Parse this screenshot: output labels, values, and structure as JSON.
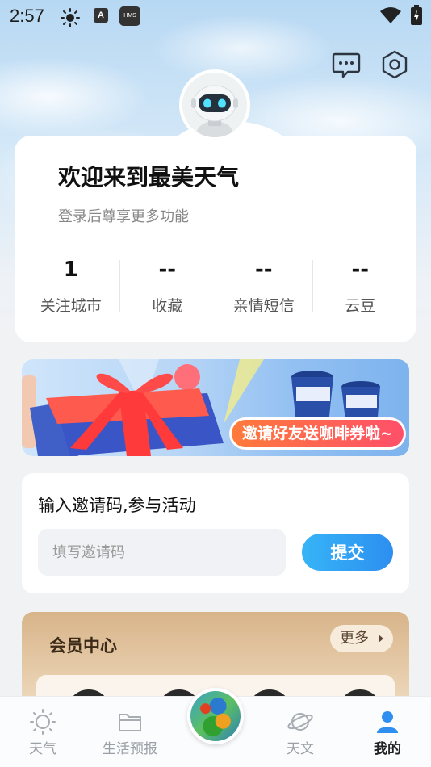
{
  "status_bar": {
    "time": "2:57",
    "icons": [
      "sun-icon",
      "a-icon",
      "hms-icon",
      "wifi-icon",
      "battery-icon"
    ],
    "a_label": "A",
    "hms_label": "HMS"
  },
  "header": {
    "message_icon": "chat-bubble-icon",
    "settings_icon": "hexagon-settings-icon"
  },
  "profile": {
    "avatar_icon": "robot-avatar",
    "title": "欢迎来到最美天气",
    "subtitle": "登录后尊享更多功能",
    "stats": [
      {
        "value": "1",
        "label": "关注城市"
      },
      {
        "value": "--",
        "label": "收藏"
      },
      {
        "value": "--",
        "label": "亲情短信"
      },
      {
        "value": "--",
        "label": "云豆"
      }
    ]
  },
  "banner": {
    "text": "邀请好友送咖啡券啦~"
  },
  "invite": {
    "title": "输入邀请码,参与活动",
    "input_value": "",
    "input_placeholder": "填写邀请码",
    "submit_label": "提交"
  },
  "member": {
    "title": "会员中心",
    "more_label": "更多"
  },
  "nav": {
    "items": [
      {
        "label": "天气",
        "icon": "sun-outline-icon",
        "active": false
      },
      {
        "label": "生活预报",
        "icon": "folder-icon",
        "active": false
      },
      {
        "label": "",
        "icon": "radar-map-icon",
        "active": false
      },
      {
        "label": "天文",
        "icon": "planet-icon",
        "active": false
      },
      {
        "label": "我的",
        "icon": "user-icon",
        "active": true
      }
    ]
  },
  "colors": {
    "accent_blue": "#2d8ff0",
    "member_gold": "#d8b48a",
    "banner_pill": "#ff6a4a"
  }
}
